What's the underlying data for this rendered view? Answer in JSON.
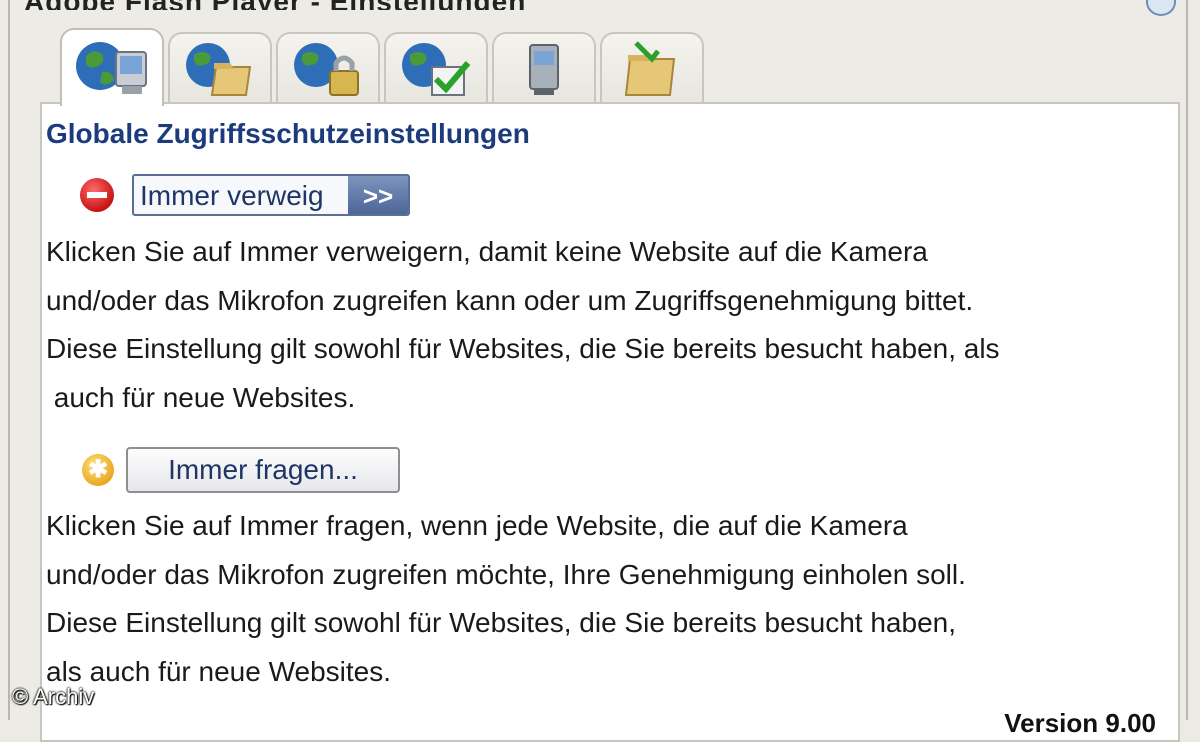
{
  "window": {
    "title": "Adobe Flash Player - Einstellungen"
  },
  "tabs": [
    {
      "icon": "globe-monitor-icon",
      "active": true
    },
    {
      "icon": "globe-folder-icon",
      "active": false
    },
    {
      "icon": "globe-lock-icon",
      "active": false
    },
    {
      "icon": "globe-checkmark-icon",
      "active": false
    },
    {
      "icon": "computer-tower-icon",
      "active": false
    },
    {
      "icon": "folder-arrow-icon",
      "active": false
    }
  ],
  "content": {
    "heading": "Globale Zugriffsschutzeinstellungen",
    "deny_button": {
      "label": "Immer verweig",
      "arrows": ">>"
    },
    "deny_text": [
      "Klicken Sie auf Immer verweigern, damit keine Website auf die Kamera",
      "und/oder das Mikrofon zugreifen kann oder um Zugriffsgenehmigung bittet.",
      "Diese Einstellung gilt sowohl für Websites, die Sie bereits besucht haben, als",
      " auch für neue Websites."
    ],
    "ask_button": {
      "label": "Immer fragen..."
    },
    "ask_text": [
      "Klicken Sie auf Immer fragen, wenn jede Website, die auf die Kamera",
      "und/oder das Mikrofon zugreifen möchte, Ihre Genehmigung einholen soll.",
      "Diese Einstellung gilt sowohl für Websites, die Sie bereits besucht haben,",
      "als auch für neue Websites."
    ]
  },
  "footer": {
    "copyright": "© Archiv",
    "version": "Version 9.00"
  },
  "colors": {
    "heading": "#1c3b7d",
    "deny_icon": "#d01f1f",
    "ask_icon": "#f0b12c"
  }
}
